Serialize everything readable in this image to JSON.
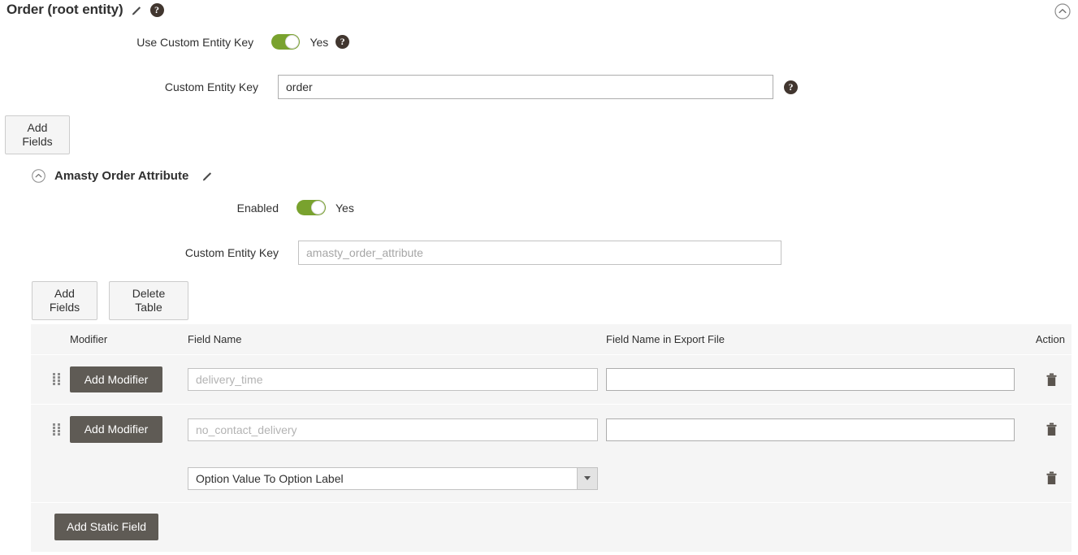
{
  "root": {
    "title": "Order (root entity)",
    "edit_icon": "pencil-icon",
    "help_icon": "help-icon",
    "collapse_icon": "chevron-up-circle-icon",
    "use_custom_entity_key": {
      "label": "Use Custom Entity Key",
      "toggle_state": "Yes",
      "toggle_on": true
    },
    "custom_entity_key": {
      "label": "Custom Entity Key",
      "value": "order",
      "placeholder": ""
    },
    "add_fields_label": "Add Fields"
  },
  "section": {
    "title": "Amasty Order Attribute",
    "collapse_icon": "chevron-up-circle-icon",
    "edit_icon": "pencil-icon",
    "enabled": {
      "label": "Enabled",
      "toggle_state": "Yes",
      "toggle_on": true
    },
    "custom_entity_key": {
      "label": "Custom Entity Key",
      "value": "",
      "placeholder": "amasty_order_attribute"
    },
    "add_fields_label": "Add Fields",
    "delete_table_label": "Delete Table",
    "add_static_field_label": "Add Static Field"
  },
  "table": {
    "headers": {
      "modifier": "Modifier",
      "field_name": "Field Name",
      "field_name_export": "Field Name in Export File",
      "action": "Action"
    },
    "rows": [
      {
        "drag_handle": "drag-handle-icon",
        "modifier_label": "Add Modifier",
        "field_name_value": "",
        "field_name_placeholder": "delivery_time",
        "export_name_value": "",
        "export_name_placeholder": "",
        "delete_icon": "trash-icon"
      },
      {
        "drag_handle": "drag-handle-icon",
        "modifier_label": "Add Modifier",
        "field_name_value": "",
        "field_name_placeholder": "no_contact_delivery",
        "export_name_value": "",
        "export_name_placeholder": "",
        "delete_icon": "trash-icon"
      }
    ],
    "modifier_row": {
      "select_value": "Option Value To Option Label",
      "options": [
        "Option Value To Option Label"
      ],
      "delete_icon": "trash-icon"
    }
  },
  "colors": {
    "toggle_on": "#79a22e",
    "dark_button": "#5f5b55",
    "table_bg": "#f5f5f5",
    "text": "#303030"
  }
}
